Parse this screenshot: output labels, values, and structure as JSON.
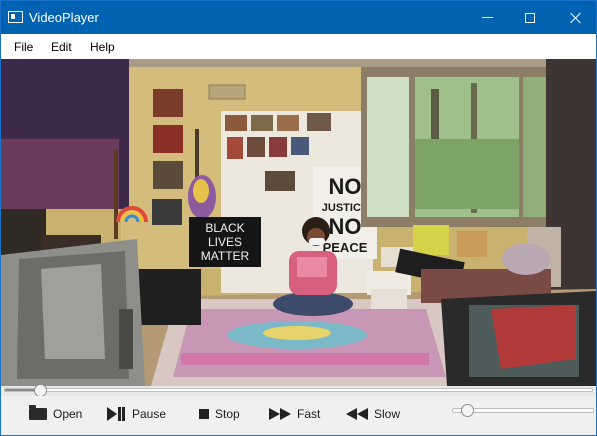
{
  "window": {
    "title": "VideoPlayer",
    "icon": "app-window-icon"
  },
  "menu": [
    "File",
    "Edit",
    "Help"
  ],
  "video": {
    "description_icon": "video-frame",
    "signs": {
      "blm": [
        "BLACK",
        "LIVES",
        "MATTER"
      ],
      "no_justice": [
        "NO",
        "JUSTICE",
        "NO",
        "PEACE"
      ]
    }
  },
  "playback": {
    "progress": 0.06
  },
  "controls": {
    "open": {
      "label": "Open",
      "icon": "folder-icon"
    },
    "pause": {
      "label": "Pause",
      "icon": "play-pause-icon"
    },
    "stop": {
      "label": "Stop",
      "icon": "stop-icon"
    },
    "fast": {
      "label": "Fast",
      "icon": "fast-forward-icon"
    },
    "slow": {
      "label": "Slow",
      "icon": "rewind-icon"
    }
  },
  "volume": {
    "level": 0.1
  }
}
